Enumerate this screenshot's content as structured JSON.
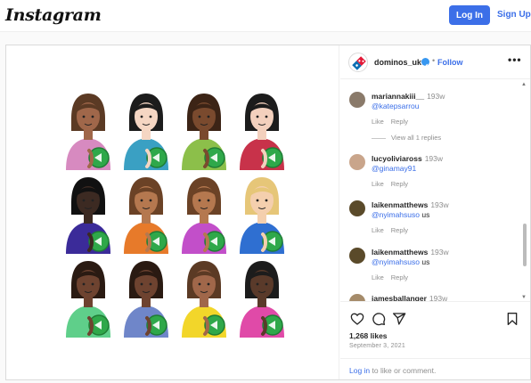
{
  "topbar": {
    "logo": "Instagram",
    "login_label": "Log In",
    "signup_label": "Sign Up"
  },
  "post": {
    "account": "dominos_uk",
    "separator": "•",
    "follow_label": "Follow",
    "more_label": "•••",
    "likes": "1,268 likes",
    "date": "September 3, 2021",
    "login_prompt": {
      "link": "Log in",
      "rest": " to like or comment."
    },
    "image": {
      "figures": [
        {
          "skin": "#a0674a",
          "hair": "#5b3a24",
          "shirt": "#d78ac0"
        },
        {
          "skin": "#f5d6c3",
          "hair": "#1c1c1c",
          "shirt": "#3aa0c3"
        },
        {
          "skin": "#7a4a2e",
          "hair": "#3c2416",
          "shirt": "#8cbf4a"
        },
        {
          "skin": "#f3d0bd",
          "hair": "#1c1c1c",
          "shirt": "#c8324a"
        },
        {
          "skin": "#3c2a22",
          "hair": "#111111",
          "shirt": "#3b2b99"
        },
        {
          "skin": "#b5784f",
          "hair": "#6b4226",
          "shirt": "#e77a2a"
        },
        {
          "skin": "#b5784f",
          "hair": "#6b4226",
          "shirt": "#c24fc9"
        },
        {
          "skin": "#f4cfae",
          "hair": "#e6c678",
          "shirt": "#2f6fd1"
        },
        {
          "skin": "#6e4330",
          "hair": "#2a1a12",
          "shirt": "#5fcf8a"
        },
        {
          "skin": "#6e4330",
          "hair": "#2a1a12",
          "shirt": "#6f86c9"
        },
        {
          "skin": "#a0674a",
          "hair": "#5b3a24",
          "shirt": "#f2d62a"
        },
        {
          "skin": "#5a3a2a",
          "hair": "#1c1c1c",
          "shirt": "#e04aa8"
        }
      ]
    }
  },
  "comments": [
    {
      "user": "mariannakiii__",
      "time": "193w",
      "mention": "@katepsarrou",
      "text": "",
      "like": "Like",
      "reply": "Reply",
      "avatar": "#8a7a6a"
    },
    {
      "user": "lucyoliviaross",
      "time": "193w",
      "mention": "@ginamay91",
      "text": "",
      "like": "Like",
      "reply": "Reply",
      "avatar": "#c9a58b"
    },
    {
      "user": "laikenmatthews",
      "time": "193w",
      "mention": "@nyimahsuso",
      "text": " us",
      "like": "Like",
      "reply": "Reply",
      "avatar": "#5a4a2a"
    },
    {
      "user": "laikenmatthews",
      "time": "193w",
      "mention": "@nyimahsuso",
      "text": " us",
      "like": "Like",
      "reply": "Reply",
      "avatar": "#5a4a2a"
    },
    {
      "user": "jamesballanger",
      "time": "193w",
      "mention": "",
      "text": "",
      "like": "",
      "reply": "",
      "avatar": "#a58b6a"
    }
  ],
  "view_replies": "View all 1 replies",
  "colors": {
    "accent": "#3a6ee8",
    "login_button": "#3c6fe8",
    "muted": "#8e8e8e",
    "verified": "#3897f0"
  },
  "icons": [
    "heart-icon",
    "comment-icon",
    "share-icon",
    "bookmark-icon",
    "verified-icon",
    "more-icon"
  ]
}
